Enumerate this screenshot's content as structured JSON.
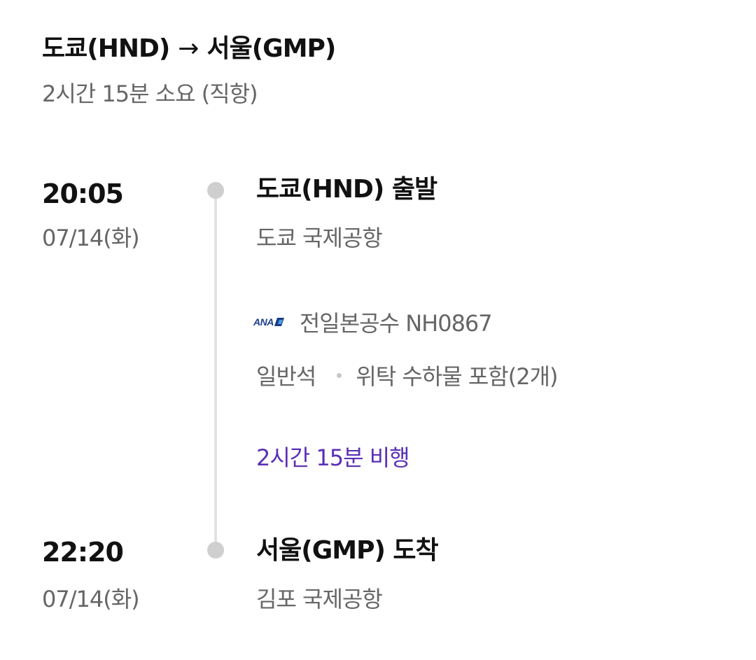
{
  "route": {
    "origin": "도쿄(HND)",
    "arrow": "→",
    "destination": "서울(GMP)",
    "summary": "2시간 15분 소요 (직항)"
  },
  "departure": {
    "time": "20:05",
    "date": "07/14(화)",
    "title": "도쿄(HND) 출발",
    "airport": "도쿄 국제공항"
  },
  "flight": {
    "airline_logo_text": "ANA",
    "airline_and_number": "전일본공수 NH0867",
    "cabin_class": "일반석",
    "baggage": "위탁 수하물 포함(2개)",
    "duration": "2시간 15분 비행"
  },
  "arrival": {
    "time": "22:20",
    "date": "07/14(화)",
    "title": "서울(GMP) 도착",
    "airport": "김포 국제공항"
  },
  "colors": {
    "accent": "#5b2fb5",
    "timeline": "#e2e2e2",
    "dot": "#cfcfcf",
    "secondary_text": "#666666",
    "airline_brand": "#1a3c8c"
  }
}
